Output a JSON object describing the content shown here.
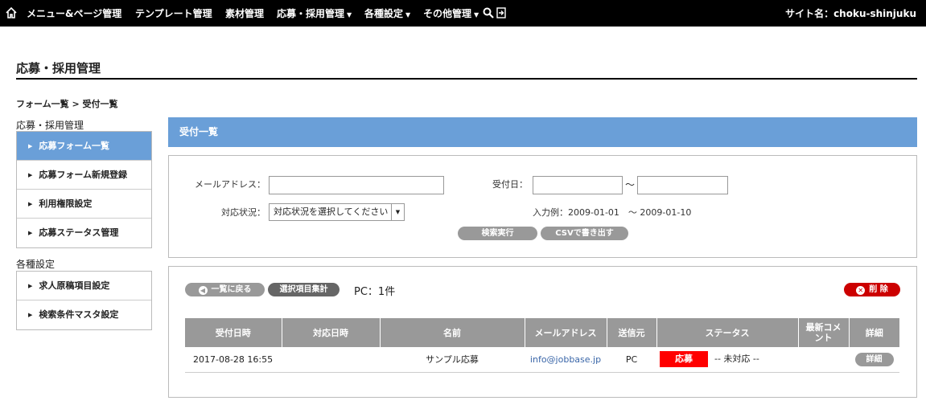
{
  "nav": {
    "items": [
      {
        "label": "メニュー&ページ管理",
        "dropdown": false
      },
      {
        "label": "テンプレート管理",
        "dropdown": false
      },
      {
        "label": "素材管理",
        "dropdown": false
      },
      {
        "label": "応募・採用管理",
        "dropdown": true
      },
      {
        "label": "各種設定",
        "dropdown": true
      },
      {
        "label": "その他管理",
        "dropdown": true
      }
    ],
    "caret": "▼",
    "site_name": "サイト名：choku-shinjuku"
  },
  "page": {
    "title": "応募・採用管理",
    "breadcrumb": "フォーム一覧 > 受付一覧"
  },
  "sidebar": {
    "groups": [
      {
        "heading": "応募・採用管理",
        "items": [
          {
            "label": "応募フォーム一覧",
            "active": true
          },
          {
            "label": "応募フォーム新規登録",
            "active": false
          },
          {
            "label": "利用権限設定",
            "active": false
          },
          {
            "label": "応募ステータス管理",
            "active": false
          }
        ]
      },
      {
        "heading": "各種設定",
        "items": [
          {
            "label": "求人原稿項目設定",
            "active": false
          },
          {
            "label": "検索条件マスタ設定",
            "active": false
          }
        ]
      }
    ]
  },
  "main": {
    "header": "受付一覧",
    "search": {
      "email_label": "メールアドレス：",
      "email_value": "",
      "date_label": "受付日：",
      "date_from": "",
      "date_to": "",
      "tilde": "〜",
      "status_label": "対応状況：",
      "status_selected": "対応状況を選択してください",
      "date_hint": "入力例：2009-01-01　〜 2009-01-10",
      "search_button": "検索実行",
      "csv_button": "CSVで書き出す"
    },
    "list": {
      "back_button": "一覧に戻る",
      "aggregate_button": "選択項目集計",
      "count": "PC：1件",
      "delete_button": "削 除",
      "columns": [
        "受付日時",
        "対応日時",
        "名前",
        "メールアドレス",
        "送信元",
        "ステータス",
        "最新コメント",
        "詳細"
      ],
      "rows": [
        {
          "received": "2017-08-28 16:55",
          "handled": "",
          "name": "サンプル応募",
          "email": "info@jobbase.jp",
          "source": "PC",
          "status": "応募",
          "status_note": "-- 未対応 --",
          "comment": "",
          "detail": "詳細"
        }
      ]
    }
  },
  "colors": {
    "accent": "#6a9fd8",
    "status": "#ff0000",
    "delete": "#cc0000"
  }
}
